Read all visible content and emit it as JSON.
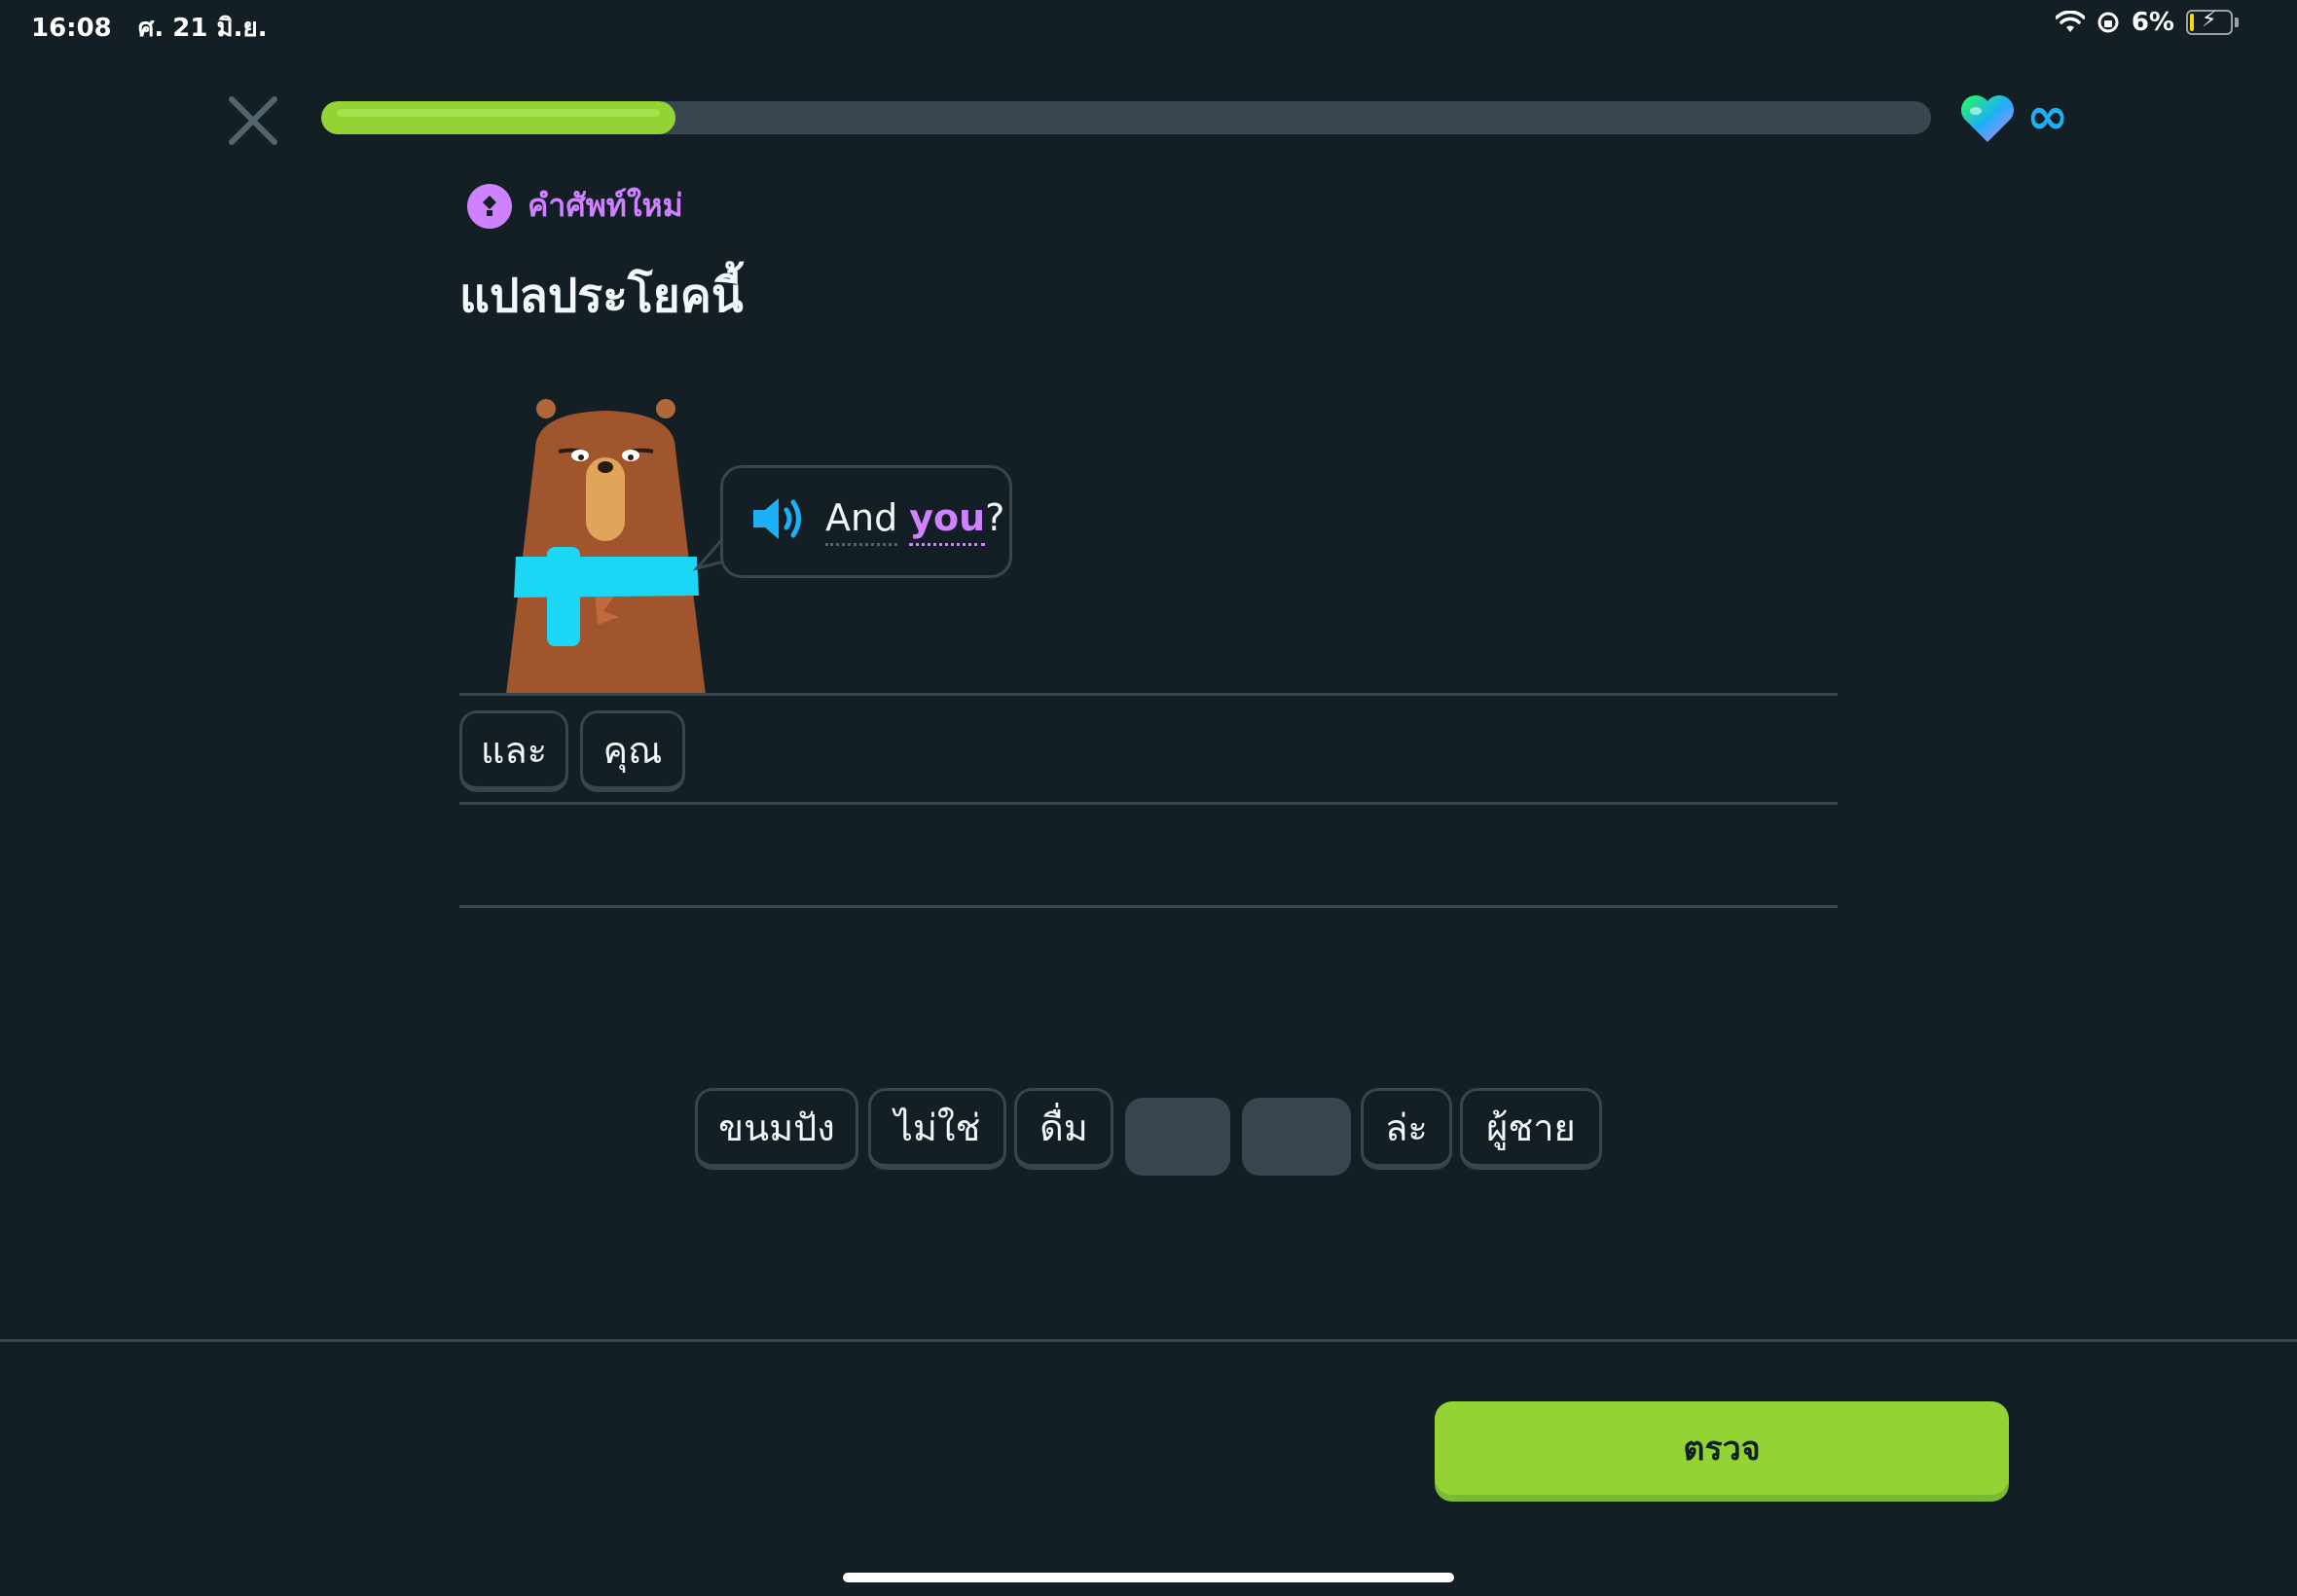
{
  "status_bar": {
    "time": "16:08",
    "date": "ศ. 21 มิ.ย.",
    "battery": "6%"
  },
  "lesson": {
    "progress_percent": 22,
    "hearts": "∞"
  },
  "header": {
    "badge_label": "คำศัพท์ใหม่",
    "title": "แปลประโยคนี้"
  },
  "prompt": {
    "words": [
      "And",
      "you"
    ],
    "punctuation": "?"
  },
  "answer_tiles": [
    "และ",
    "คุณ"
  ],
  "word_bank": [
    "ขนมปัง",
    "ไม่ใช่",
    "ดื่ม",
    "",
    "",
    "ล่ะ",
    "ผู้ชาย"
  ],
  "footer": {
    "check_label": "ตรวจ"
  },
  "colors": {
    "background": "#131f24",
    "accent_green": "#93d333",
    "accent_purple": "#ce82ff",
    "speaker_blue": "#1cb0f6",
    "border": "#37464f"
  }
}
